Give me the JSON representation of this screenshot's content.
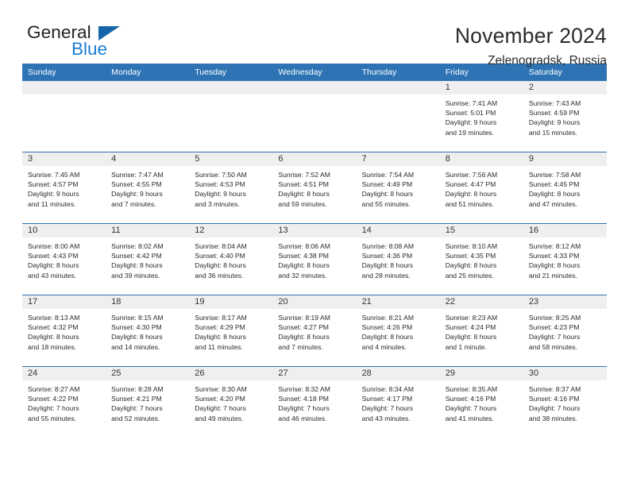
{
  "brand": {
    "name_part1": "General",
    "name_part2": "Blue"
  },
  "header": {
    "title": "November 2024",
    "subtitle": "Zelenogradsk, Russia"
  },
  "colors": {
    "header_blue": "#2E74B5",
    "logo_blue": "#1A7FD4",
    "logo_triangle": "#1565A8",
    "daynum_band": "#EFEFEF"
  },
  "weekday_headers": [
    "Sunday",
    "Monday",
    "Tuesday",
    "Wednesday",
    "Thursday",
    "Friday",
    "Saturday"
  ],
  "weeks": [
    [
      {
        "day": "",
        "lines": []
      },
      {
        "day": "",
        "lines": []
      },
      {
        "day": "",
        "lines": []
      },
      {
        "day": "",
        "lines": []
      },
      {
        "day": "",
        "lines": []
      },
      {
        "day": "1",
        "lines": [
          "Sunrise: 7:41 AM",
          "Sunset: 5:01 PM",
          "Daylight: 9 hours",
          "and 19 minutes."
        ]
      },
      {
        "day": "2",
        "lines": [
          "Sunrise: 7:43 AM",
          "Sunset: 4:59 PM",
          "Daylight: 9 hours",
          "and 15 minutes."
        ]
      }
    ],
    [
      {
        "day": "3",
        "lines": [
          "Sunrise: 7:45 AM",
          "Sunset: 4:57 PM",
          "Daylight: 9 hours",
          "and 11 minutes."
        ]
      },
      {
        "day": "4",
        "lines": [
          "Sunrise: 7:47 AM",
          "Sunset: 4:55 PM",
          "Daylight: 9 hours",
          "and 7 minutes."
        ]
      },
      {
        "day": "5",
        "lines": [
          "Sunrise: 7:50 AM",
          "Sunset: 4:53 PM",
          "Daylight: 9 hours",
          "and 3 minutes."
        ]
      },
      {
        "day": "6",
        "lines": [
          "Sunrise: 7:52 AM",
          "Sunset: 4:51 PM",
          "Daylight: 8 hours",
          "and 59 minutes."
        ]
      },
      {
        "day": "7",
        "lines": [
          "Sunrise: 7:54 AM",
          "Sunset: 4:49 PM",
          "Daylight: 8 hours",
          "and 55 minutes."
        ]
      },
      {
        "day": "8",
        "lines": [
          "Sunrise: 7:56 AM",
          "Sunset: 4:47 PM",
          "Daylight: 8 hours",
          "and 51 minutes."
        ]
      },
      {
        "day": "9",
        "lines": [
          "Sunrise: 7:58 AM",
          "Sunset: 4:45 PM",
          "Daylight: 8 hours",
          "and 47 minutes."
        ]
      }
    ],
    [
      {
        "day": "10",
        "lines": [
          "Sunrise: 8:00 AM",
          "Sunset: 4:43 PM",
          "Daylight: 8 hours",
          "and 43 minutes."
        ]
      },
      {
        "day": "11",
        "lines": [
          "Sunrise: 8:02 AM",
          "Sunset: 4:42 PM",
          "Daylight: 8 hours",
          "and 39 minutes."
        ]
      },
      {
        "day": "12",
        "lines": [
          "Sunrise: 8:04 AM",
          "Sunset: 4:40 PM",
          "Daylight: 8 hours",
          "and 36 minutes."
        ]
      },
      {
        "day": "13",
        "lines": [
          "Sunrise: 8:06 AM",
          "Sunset: 4:38 PM",
          "Daylight: 8 hours",
          "and 32 minutes."
        ]
      },
      {
        "day": "14",
        "lines": [
          "Sunrise: 8:08 AM",
          "Sunset: 4:36 PM",
          "Daylight: 8 hours",
          "and 28 minutes."
        ]
      },
      {
        "day": "15",
        "lines": [
          "Sunrise: 8:10 AM",
          "Sunset: 4:35 PM",
          "Daylight: 8 hours",
          "and 25 minutes."
        ]
      },
      {
        "day": "16",
        "lines": [
          "Sunrise: 8:12 AM",
          "Sunset: 4:33 PM",
          "Daylight: 8 hours",
          "and 21 minutes."
        ]
      }
    ],
    [
      {
        "day": "17",
        "lines": [
          "Sunrise: 8:13 AM",
          "Sunset: 4:32 PM",
          "Daylight: 8 hours",
          "and 18 minutes."
        ]
      },
      {
        "day": "18",
        "lines": [
          "Sunrise: 8:15 AM",
          "Sunset: 4:30 PM",
          "Daylight: 8 hours",
          "and 14 minutes."
        ]
      },
      {
        "day": "19",
        "lines": [
          "Sunrise: 8:17 AM",
          "Sunset: 4:29 PM",
          "Daylight: 8 hours",
          "and 11 minutes."
        ]
      },
      {
        "day": "20",
        "lines": [
          "Sunrise: 8:19 AM",
          "Sunset: 4:27 PM",
          "Daylight: 8 hours",
          "and 7 minutes."
        ]
      },
      {
        "day": "21",
        "lines": [
          "Sunrise: 8:21 AM",
          "Sunset: 4:26 PM",
          "Daylight: 8 hours",
          "and 4 minutes."
        ]
      },
      {
        "day": "22",
        "lines": [
          "Sunrise: 8:23 AM",
          "Sunset: 4:24 PM",
          "Daylight: 8 hours",
          "and 1 minute."
        ]
      },
      {
        "day": "23",
        "lines": [
          "Sunrise: 8:25 AM",
          "Sunset: 4:23 PM",
          "Daylight: 7 hours",
          "and 58 minutes."
        ]
      }
    ],
    [
      {
        "day": "24",
        "lines": [
          "Sunrise: 8:27 AM",
          "Sunset: 4:22 PM",
          "Daylight: 7 hours",
          "and 55 minutes."
        ]
      },
      {
        "day": "25",
        "lines": [
          "Sunrise: 8:28 AM",
          "Sunset: 4:21 PM",
          "Daylight: 7 hours",
          "and 52 minutes."
        ]
      },
      {
        "day": "26",
        "lines": [
          "Sunrise: 8:30 AM",
          "Sunset: 4:20 PM",
          "Daylight: 7 hours",
          "and 49 minutes."
        ]
      },
      {
        "day": "27",
        "lines": [
          "Sunrise: 8:32 AM",
          "Sunset: 4:18 PM",
          "Daylight: 7 hours",
          "and 46 minutes."
        ]
      },
      {
        "day": "28",
        "lines": [
          "Sunrise: 8:34 AM",
          "Sunset: 4:17 PM",
          "Daylight: 7 hours",
          "and 43 minutes."
        ]
      },
      {
        "day": "29",
        "lines": [
          "Sunrise: 8:35 AM",
          "Sunset: 4:16 PM",
          "Daylight: 7 hours",
          "and 41 minutes."
        ]
      },
      {
        "day": "30",
        "lines": [
          "Sunrise: 8:37 AM",
          "Sunset: 4:16 PM",
          "Daylight: 7 hours",
          "and 38 minutes."
        ]
      }
    ]
  ]
}
